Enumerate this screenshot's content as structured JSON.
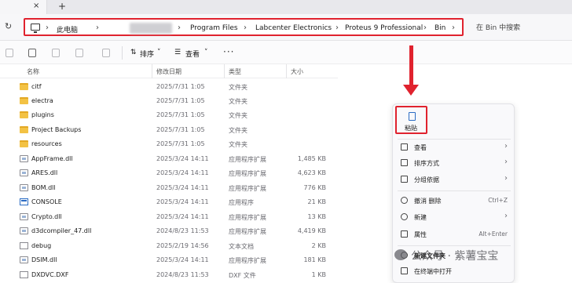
{
  "tabs": {
    "close_glyph": "×",
    "new_tab_glyph": "+"
  },
  "address": {
    "crumbs": [
      "此电脑",
      "Program Files",
      "Labcenter Electronics",
      "Proteus 9 Professional",
      "Bin"
    ],
    "search_placeholder": "在 Bin 中搜索"
  },
  "toolbar": {
    "sort_label": "排序",
    "view_label": "查看",
    "more_glyph": "···"
  },
  "columns": {
    "name": "名称",
    "date": "修改日期",
    "type": "类型",
    "size": "大小"
  },
  "files": [
    {
      "name": "citf",
      "date": "2025/7/31 1:05",
      "type": "文件夹",
      "size": "",
      "icon": "folder-icon"
    },
    {
      "name": "electra",
      "date": "2025/7/31 1:05",
      "type": "文件夹",
      "size": "",
      "icon": "folder-icon"
    },
    {
      "name": "plugins",
      "date": "2025/7/31 1:05",
      "type": "文件夹",
      "size": "",
      "icon": "folder-icon"
    },
    {
      "name": "Project Backups",
      "date": "2025/7/31 1:05",
      "type": "文件夹",
      "size": "",
      "icon": "folder-icon"
    },
    {
      "name": "resources",
      "date": "2025/7/31 1:05",
      "type": "文件夹",
      "size": "",
      "icon": "folder-icon"
    },
    {
      "name": "AppFrame.dll",
      "date": "2025/3/24 14:11",
      "type": "应用程序扩展",
      "size": "1,485 KB",
      "icon": "dll-icon"
    },
    {
      "name": "ARES.dll",
      "date": "2025/3/24 14:11",
      "type": "应用程序扩展",
      "size": "4,623 KB",
      "icon": "dll-icon"
    },
    {
      "name": "BOM.dll",
      "date": "2025/3/24 14:11",
      "type": "应用程序扩展",
      "size": "776 KB",
      "icon": "dll-icon"
    },
    {
      "name": "CONSOLE",
      "date": "2025/3/24 14:11",
      "type": "应用程序",
      "size": "21 KB",
      "icon": "exe-icon"
    },
    {
      "name": "Crypto.dll",
      "date": "2025/3/24 14:11",
      "type": "应用程序扩展",
      "size": "13 KB",
      "icon": "dll-icon"
    },
    {
      "name": "d3dcompiler_47.dll",
      "date": "2024/8/23 11:53",
      "type": "应用程序扩展",
      "size": "4,419 KB",
      "icon": "dll-icon"
    },
    {
      "name": "debug",
      "date": "2025/2/19 14:56",
      "type": "文本文档",
      "size": "2 KB",
      "icon": "file-icon"
    },
    {
      "name": "DSIM.dll",
      "date": "2025/3/24 14:11",
      "type": "应用程序扩展",
      "size": "181 KB",
      "icon": "dll-icon"
    },
    {
      "name": "DXDVC.DXF",
      "date": "2024/8/23 11:53",
      "type": "DXF 文件",
      "size": "1 KB",
      "icon": "file-icon"
    }
  ],
  "context_menu": {
    "paste_label": "粘贴",
    "items": [
      {
        "label": "查看",
        "hint": "",
        "submenu": true,
        "icon": "grid-icon"
      },
      {
        "label": "排序方式",
        "hint": "",
        "submenu": true,
        "icon": "sort-icon"
      },
      {
        "label": "分组依据",
        "hint": "",
        "submenu": true,
        "icon": "group-icon"
      },
      {
        "label": "撤消 删除",
        "hint": "Ctrl+Z",
        "submenu": false,
        "icon": "undo-icon"
      },
      {
        "label": "新建",
        "hint": "",
        "submenu": true,
        "icon": "new-icon"
      },
      {
        "label": "属性",
        "hint": "Alt+Enter",
        "submenu": false,
        "icon": "properties-icon"
      },
      {
        "label": "新建文件夹",
        "hint": "",
        "submenu": false,
        "icon": "new-folder-icon"
      },
      {
        "label": "在终端中打开",
        "hint": "",
        "submenu": false,
        "icon": "terminal-icon"
      }
    ]
  },
  "watermark": {
    "text": "公众号 · 紫薯宝宝"
  },
  "colors": {
    "highlight": "#e0222e",
    "folder": "#f3c244",
    "accent": "#2b6cc4"
  }
}
